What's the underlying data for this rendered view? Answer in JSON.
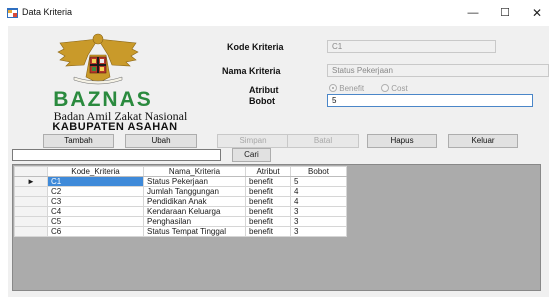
{
  "window": {
    "title": "Data Kriteria",
    "controls": {
      "minimize": "—",
      "maximize": "☐",
      "close": "✕"
    }
  },
  "logo": {
    "brand": "BAZNAS",
    "line1": "Badan Amil Zakat Nasional",
    "line2": "KABUPATEN ASAHAN",
    "brand_color": "#2a8a3e"
  },
  "form": {
    "kode_label": "Kode Kriteria",
    "kode_value": "C1",
    "nama_label": "Nama Kriteria",
    "nama_value": "Status Pekerjaan",
    "atribut_label": "Atribut",
    "atribut_options": [
      "Benefit",
      "Cost"
    ],
    "atribut_selected": "Benefit",
    "bobot_label": "Bobot",
    "bobot_value": "5"
  },
  "toolbar": {
    "tambah": "Tambah",
    "ubah": "Ubah",
    "simpan": "Simpan",
    "batal": "Batal",
    "hapus": "Hapus",
    "keluar": "Keluar"
  },
  "search": {
    "value": "",
    "button": "Cari"
  },
  "grid": {
    "columns": [
      "Kode_Kriteria",
      "Nama_Kriteria",
      "Atribut",
      "Bobot"
    ],
    "selected_marker": "►",
    "rows": [
      {
        "kode": "C1",
        "nama": "Status Pekerjaan",
        "atribut": "benefit",
        "bobot": "5"
      },
      {
        "kode": "C2",
        "nama": "Jumlah Tanggungan",
        "atribut": "benefit",
        "bobot": "4"
      },
      {
        "kode": "C3",
        "nama": "Pendidikan Anak",
        "atribut": "benefit",
        "bobot": "4"
      },
      {
        "kode": "C4",
        "nama": "Kendaraan Keluarga",
        "atribut": "benefit",
        "bobot": "3"
      },
      {
        "kode": "C5",
        "nama": "Penghasilan",
        "atribut": "benefit",
        "bobot": "3"
      },
      {
        "kode": "C6",
        "nama": "Status Tempat Tinggal",
        "atribut": "benefit",
        "bobot": "3"
      }
    ]
  },
  "colors": {
    "selection": "#3f8ad9",
    "grid_background": "#ababab",
    "focus_border": "#4a86c8"
  }
}
